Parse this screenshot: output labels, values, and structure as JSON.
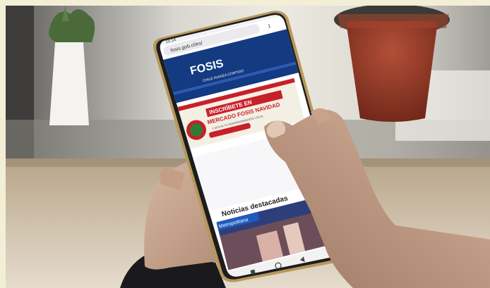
{
  "phone": {
    "status_time": "15:14",
    "url": "fosis.gob.cl/es/",
    "tab_count": "1"
  },
  "site": {
    "logo": "FOSIS",
    "tagline": "CHILE AVANZA CONTIGO",
    "banner_line1": "INSCRÍBETE EN",
    "banner_line2": "MERCADO FOSIS NAVIDAD",
    "banner_line3": "Y APOYA TU EMPRENDIMIENTO LOCAL",
    "section_heading": "Noticias destacadas",
    "news_tag": "Metropolitana"
  },
  "colors": {
    "wall": "#f3efd6",
    "fosis_blue": "#143a82",
    "banner_red": "#c8202a",
    "banner_green": "#2e7d32",
    "phone_bezel": "#1d1d1f",
    "phone_frame_gold": "#b8975a",
    "skin": "#caa892",
    "sleeve": "#1a1a1d"
  },
  "icons": {
    "plant": "potted-plant-icon",
    "home": "home-icon",
    "back": "back-icon",
    "recents": "recents-icon"
  }
}
